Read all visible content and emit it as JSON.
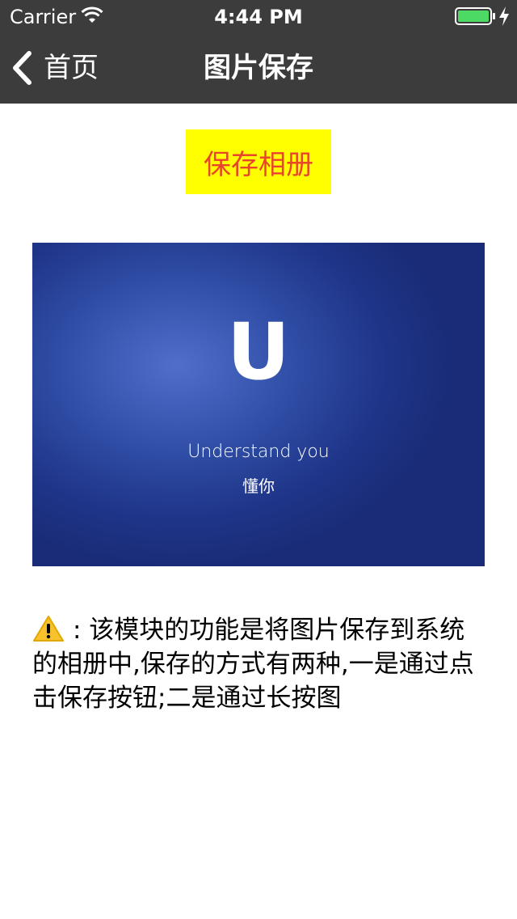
{
  "status_bar": {
    "carrier": "Carrier",
    "time": "4:44 PM",
    "icons": [
      "wifi-icon",
      "battery-icon",
      "charging-icon"
    ]
  },
  "nav": {
    "back_label": "首页",
    "title": "图片保存"
  },
  "save_button": {
    "label": "保存相册"
  },
  "image": {
    "letter": "U",
    "caption": "Understand you",
    "subcaption": "懂你"
  },
  "description": {
    "text": ": 该模块的功能是将图片保存到系统的相册中,保存的方式有两种,一是通过点击保存按钮;二是通过长按图"
  },
  "colors": {
    "header_bg": "#3c3c3c",
    "button_bg": "#ffff00",
    "button_text": "#e8452a",
    "battery": "#4cd964",
    "image_blue": "#2e4ca4"
  }
}
